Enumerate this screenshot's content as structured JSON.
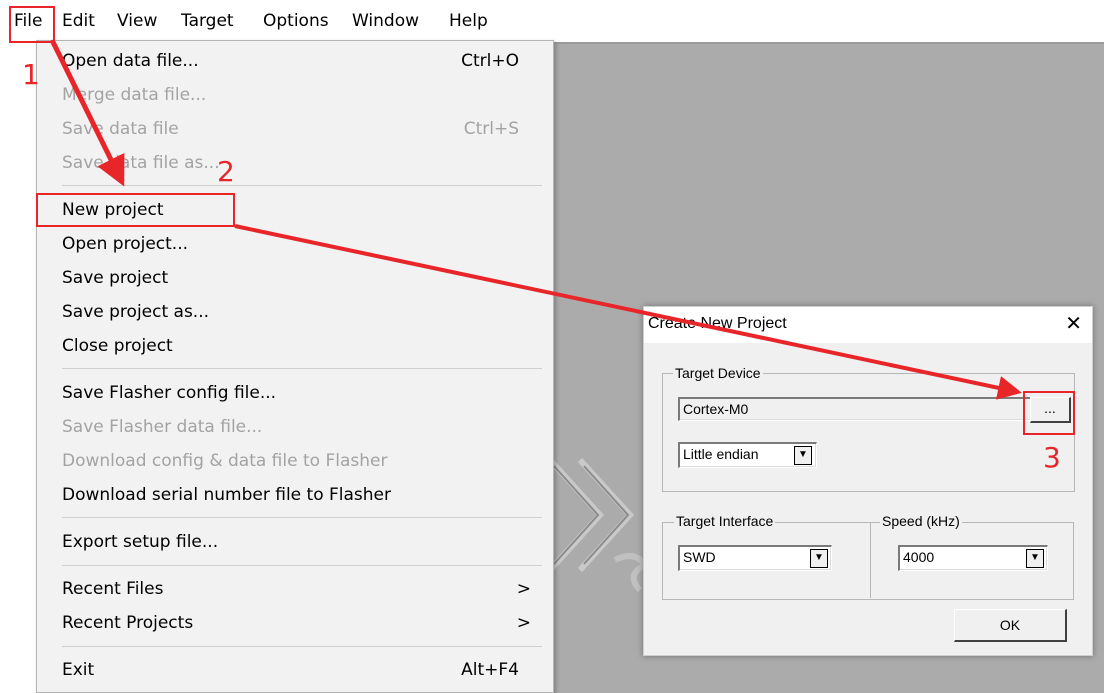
{
  "menubar": {
    "items": [
      "File",
      "Edit",
      "View",
      "Target",
      "Options",
      "Window",
      "Help"
    ]
  },
  "file_menu": {
    "open_data_file": {
      "label": "Open data file...",
      "shortcut": "Ctrl+O"
    },
    "merge_data_file": {
      "label": "Merge data file..."
    },
    "save_data_file": {
      "label": "Save data file",
      "shortcut": "Ctrl+S"
    },
    "save_data_file_as": {
      "label": "Save data file as..."
    },
    "new_project": {
      "label": "New project"
    },
    "open_project": {
      "label": "Open project..."
    },
    "save_project": {
      "label": "Save project"
    },
    "save_project_as": {
      "label": "Save project as..."
    },
    "close_project": {
      "label": "Close project"
    },
    "save_flasher_config": {
      "label": "Save Flasher config file..."
    },
    "save_flasher_data": {
      "label": "Save Flasher data file..."
    },
    "download_config_data": {
      "label": "Download config & data file to Flasher"
    },
    "download_serial": {
      "label": "Download serial number file to Flasher"
    },
    "export_setup": {
      "label": "Export setup file..."
    },
    "recent_files": {
      "label": "Recent Files",
      "submenu_arrow": ">"
    },
    "recent_projects": {
      "label": "Recent Projects",
      "submenu_arrow": ">"
    },
    "exit": {
      "label": "Exit",
      "shortcut": "Alt+F4"
    }
  },
  "dialog": {
    "title": "Create New Project",
    "close_glyph": "✕",
    "target_device": {
      "legend": "Target Device",
      "device_value": "Cortex-M0",
      "browse_label": "...",
      "endian_value": "Little endian"
    },
    "target_interface": {
      "legend": "Target Interface",
      "value": "SWD"
    },
    "speed": {
      "legend": "Speed (kHz)",
      "value": "4000"
    },
    "ok_label": "OK"
  },
  "annotations": {
    "step1": "1",
    "step2": "2",
    "step3": "3",
    "color": "#e8262a"
  },
  "icons": {
    "combo_arrow": "chevron-down-icon",
    "submenu_arrow": "chevron-right-icon",
    "close": "close-icon"
  }
}
